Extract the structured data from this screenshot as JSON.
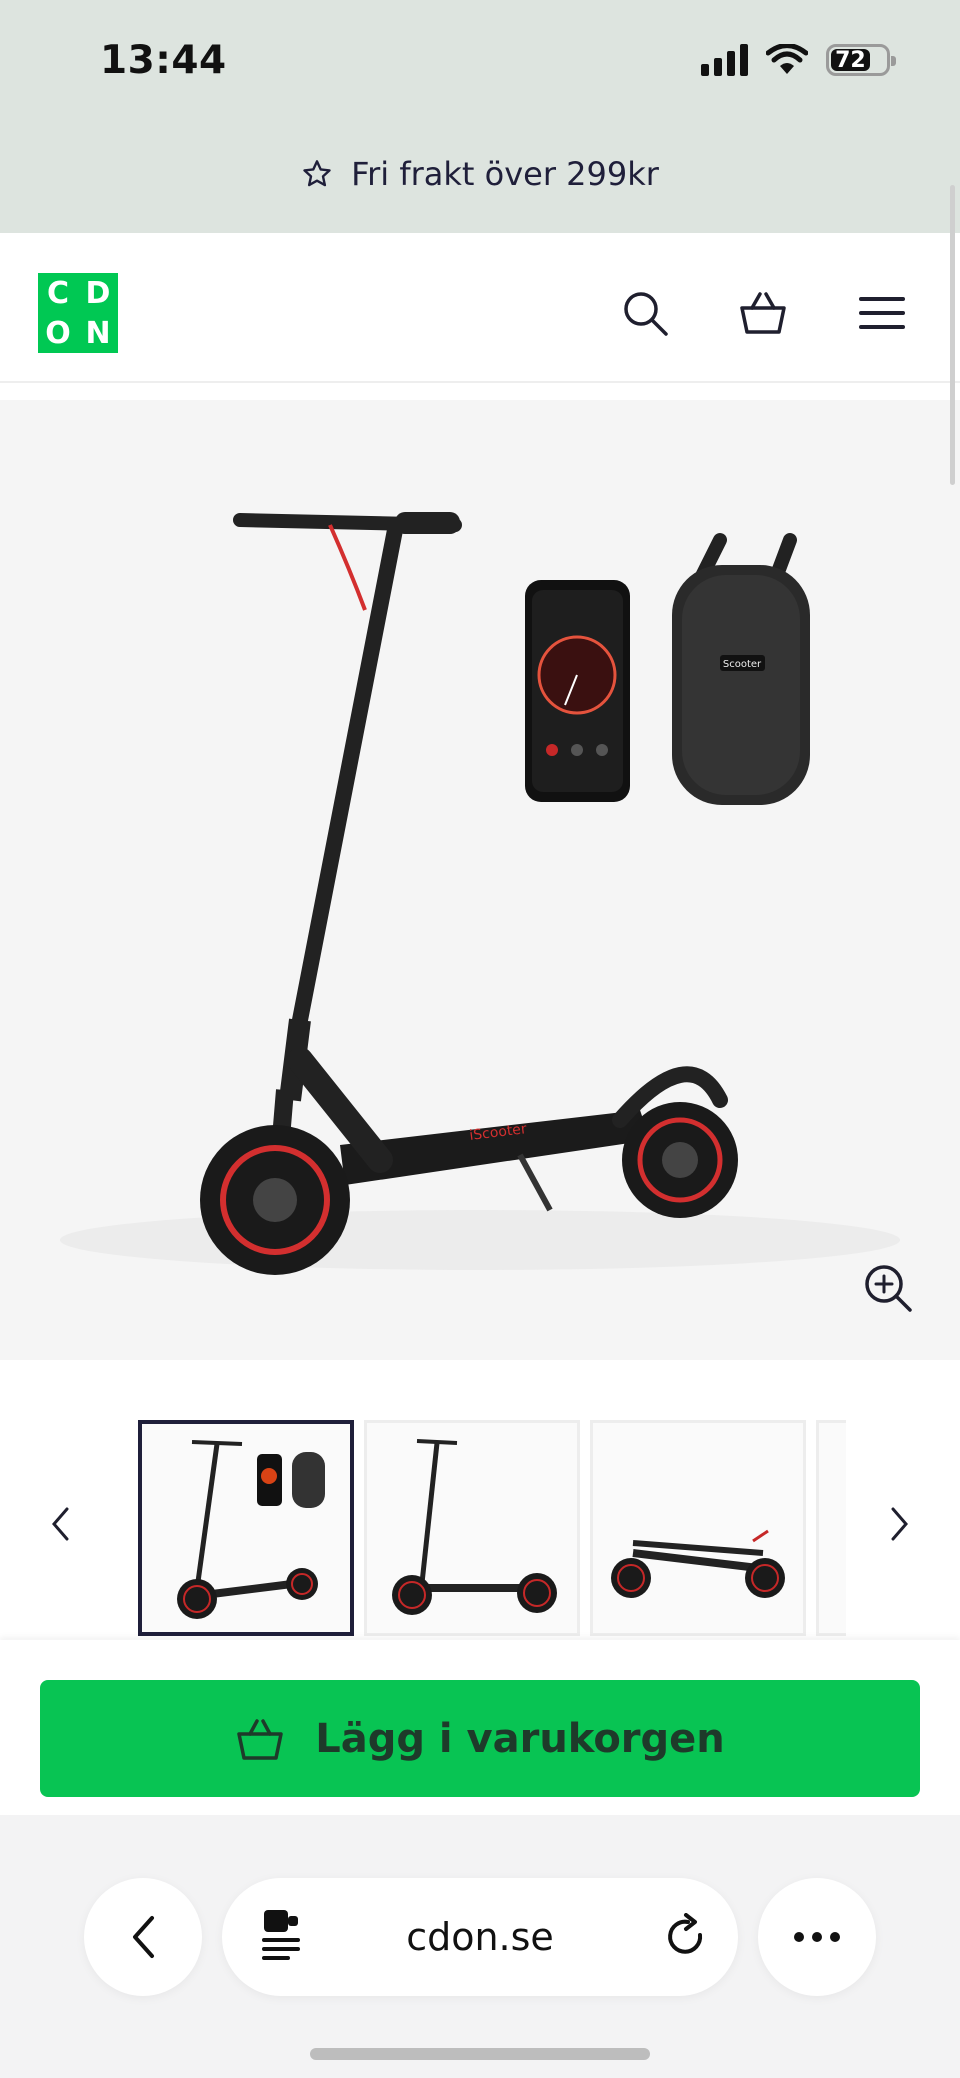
{
  "status_bar": {
    "time": "13:44",
    "battery": "72"
  },
  "promo": {
    "text": "Fri frakt över 299kr",
    "icon": "star-icon"
  },
  "header": {
    "logo_letters": [
      "C",
      "D",
      "O",
      "N"
    ],
    "icons": [
      "search-icon",
      "basket-icon",
      "menu-icon"
    ]
  },
  "product": {
    "hero_label": "Scooter",
    "thumbnails_count": 3
  },
  "cta": {
    "label": "Lägg i varukorgen",
    "icon": "basket-icon",
    "color": "#08c453"
  },
  "browser": {
    "url": "cdon.se"
  },
  "colors": {
    "brand_green": "#00c853",
    "band": "#dde4df",
    "text_dark": "#1f1f3a"
  }
}
